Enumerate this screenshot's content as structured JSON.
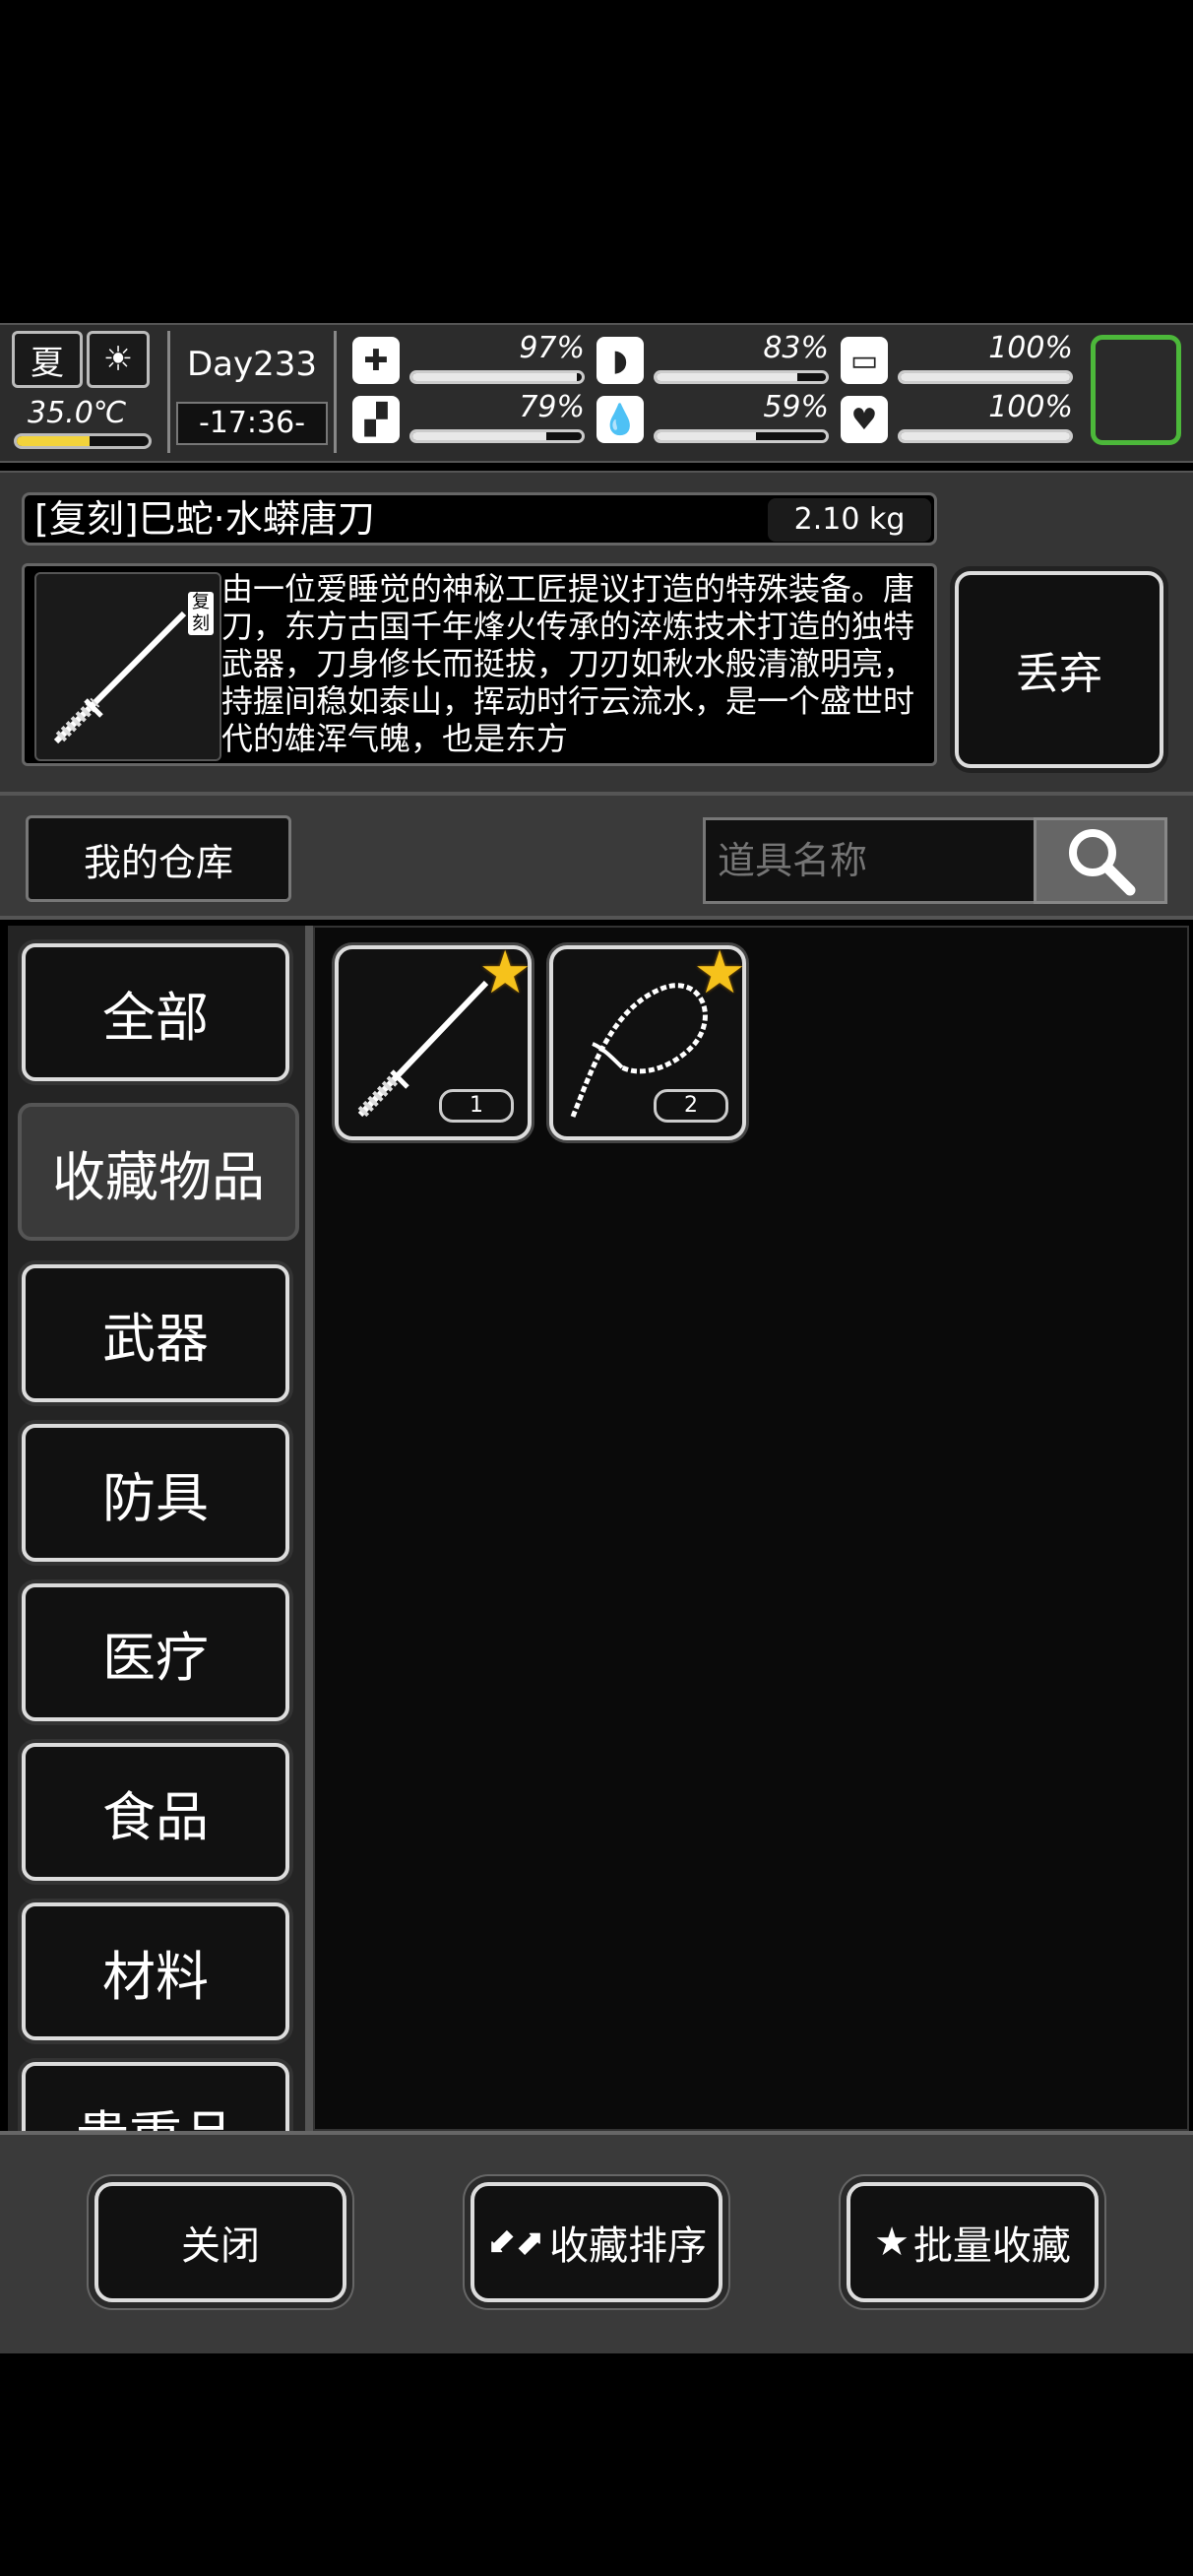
{
  "status": {
    "season": "夏",
    "temperature": "35.0℃",
    "temperature_level": 0.55,
    "day": "Day233",
    "time": "-17:36-",
    "stats": [
      {
        "icon": "medkit-icon",
        "value": "97%",
        "level": 0.97
      },
      {
        "icon": "stomach-icon",
        "value": "83%",
        "level": 0.83
      },
      {
        "icon": "bladder-icon",
        "value": "100%",
        "level": 1.0
      },
      {
        "icon": "foot-icon",
        "value": "79%",
        "level": 0.79
      },
      {
        "icon": "water-drop-icon",
        "value": "59%",
        "level": 0.59
      },
      {
        "icon": "heart-icon",
        "value": "100%",
        "level": 1.0
      }
    ]
  },
  "detail": {
    "title": "[复刻]巳蛇·水蟒唐刀",
    "weight": "2.10 kg",
    "badge": "复刻",
    "description": "由一位爱睡觉的神秘工匠提议打造的特殊装备。唐刀，东方古国千年烽火传承的淬炼技术打造的独特武器，刀身修长而挺拔，刀刃如秋水般清澈明亮，持握间稳如泰山，挥动时行云流水，是一个盛世时代的雄浑气魄，也是东方",
    "discard_label": "丢弃"
  },
  "warehouse": {
    "label": "我的仓库",
    "search_placeholder": "道具名称"
  },
  "categories": [
    "全部",
    "收藏物品",
    "武器",
    "防具",
    "医疗",
    "食品",
    "材料",
    "贵重品"
  ],
  "active_category": "收藏物品",
  "items": [
    {
      "name": "sword",
      "count": "1",
      "favorite": true
    },
    {
      "name": "whip",
      "count": "2",
      "favorite": true
    }
  ],
  "bottom": {
    "close": "关闭",
    "sort_favorites": "收藏排序",
    "batch_favorite": "批量收藏"
  },
  "colors": {
    "accent_green": "#4cb83a",
    "star": "#f6c21b",
    "temp": "#f2d33b"
  }
}
